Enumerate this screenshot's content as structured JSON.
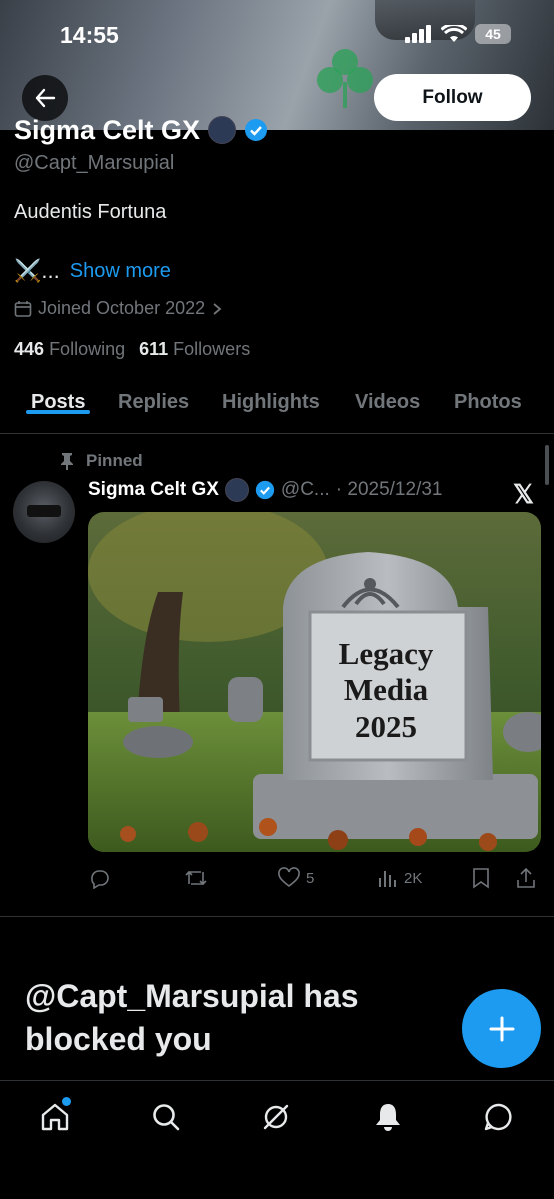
{
  "status_bar": {
    "time": "14:55",
    "battery": "45"
  },
  "header": {
    "follow_label": "Follow"
  },
  "profile": {
    "display_name": "Sigma Celt GX",
    "handle": "@Capt_Marsupial",
    "bio_line1": "Audentis Fortuna",
    "bio_line2_prefix": "⚔️...",
    "show_more": "Show more",
    "joined": "Joined October 2022",
    "following_count": "446",
    "following_label": "Following",
    "followers_count": "611",
    "followers_label": "Followers"
  },
  "tabs": [
    "Posts",
    "Replies",
    "Highlights",
    "Videos",
    "Photos"
  ],
  "post": {
    "pinned_label": "Pinned",
    "author": "Sigma Celt GX",
    "handle_short": "@C...",
    "date": "· 2025/12/31",
    "image_text": [
      "Legacy",
      "Media",
      "2025"
    ],
    "likes": "5",
    "views": "2K"
  },
  "blocked_message": "@Capt_Marsupial has blocked you",
  "colors": {
    "accent": "#1d9bf0",
    "background": "#000000",
    "muted": "#71767b"
  },
  "bottom_nav": [
    "home-icon",
    "search-icon",
    "grok-icon",
    "notifications-icon",
    "messages-icon"
  ]
}
